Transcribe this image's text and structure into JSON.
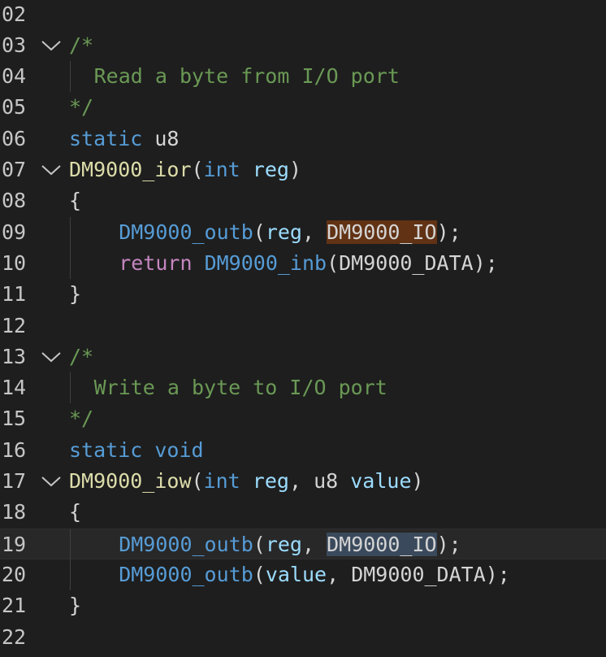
{
  "editor": {
    "lines": [
      {
        "num": "02",
        "fold": false,
        "indent": 0,
        "tokens": []
      },
      {
        "num": "03",
        "fold": true,
        "indent": 0,
        "tokens": [
          {
            "t": "/*",
            "c": "cm"
          }
        ]
      },
      {
        "num": "04",
        "fold": false,
        "indent": 2,
        "tokens": [
          {
            "t": "Read a byte from I/O port",
            "c": "cm"
          }
        ]
      },
      {
        "num": "05",
        "fold": false,
        "indent": 0,
        "tokens": [
          {
            "t": "*/",
            "c": "cm"
          }
        ]
      },
      {
        "num": "06",
        "fold": false,
        "indent": 0,
        "tokens": [
          {
            "t": "static",
            "c": "kw"
          },
          {
            "t": " ",
            "c": "pn"
          },
          {
            "t": "u8",
            "c": "pn"
          }
        ]
      },
      {
        "num": "07",
        "fold": true,
        "indent": 0,
        "tokens": [
          {
            "t": "DM9000_ior",
            "c": "fn"
          },
          {
            "t": "(",
            "c": "pn"
          },
          {
            "t": "int",
            "c": "kw"
          },
          {
            "t": " ",
            "c": "pn"
          },
          {
            "t": "reg",
            "c": "var"
          },
          {
            "t": ")",
            "c": "pn"
          }
        ]
      },
      {
        "num": "08",
        "fold": false,
        "indent": 0,
        "tokens": [
          {
            "t": "{",
            "c": "pn"
          }
        ]
      },
      {
        "num": "09",
        "fold": false,
        "indent": 4,
        "tokens": [
          {
            "t": "DM9000_outb",
            "c": "mac"
          },
          {
            "t": "(",
            "c": "pn"
          },
          {
            "t": "reg",
            "c": "var"
          },
          {
            "t": ", ",
            "c": "pn"
          },
          {
            "t": "DM9000_IO",
            "c": "pn",
            "hl": "occ"
          },
          {
            "t": ");",
            "c": "pn"
          }
        ]
      },
      {
        "num": "10",
        "fold": false,
        "indent": 4,
        "tokens": [
          {
            "t": "return",
            "c": "ctl"
          },
          {
            "t": " ",
            "c": "pn"
          },
          {
            "t": "DM9000_inb",
            "c": "mac"
          },
          {
            "t": "(DM9000_DATA);",
            "c": "pn"
          }
        ]
      },
      {
        "num": "11",
        "fold": false,
        "indent": 0,
        "tokens": [
          {
            "t": "}",
            "c": "pn"
          }
        ]
      },
      {
        "num": "12",
        "fold": false,
        "indent": 0,
        "tokens": []
      },
      {
        "num": "13",
        "fold": true,
        "indent": 0,
        "tokens": [
          {
            "t": "/*",
            "c": "cm"
          }
        ]
      },
      {
        "num": "14",
        "fold": false,
        "indent": 2,
        "tokens": [
          {
            "t": "Write a byte to I/O port",
            "c": "cm"
          }
        ]
      },
      {
        "num": "15",
        "fold": false,
        "indent": 0,
        "tokens": [
          {
            "t": "*/",
            "c": "cm"
          }
        ]
      },
      {
        "num": "16",
        "fold": false,
        "indent": 0,
        "tokens": [
          {
            "t": "static",
            "c": "kw"
          },
          {
            "t": " ",
            "c": "pn"
          },
          {
            "t": "void",
            "c": "kw"
          }
        ]
      },
      {
        "num": "17",
        "fold": true,
        "indent": 0,
        "tokens": [
          {
            "t": "DM9000_iow",
            "c": "fn"
          },
          {
            "t": "(",
            "c": "pn"
          },
          {
            "t": "int",
            "c": "kw"
          },
          {
            "t": " ",
            "c": "pn"
          },
          {
            "t": "reg",
            "c": "var"
          },
          {
            "t": ", ",
            "c": "pn"
          },
          {
            "t": "u8",
            "c": "pn"
          },
          {
            "t": " ",
            "c": "pn"
          },
          {
            "t": "value",
            "c": "var"
          },
          {
            "t": ")",
            "c": "pn"
          }
        ]
      },
      {
        "num": "18",
        "fold": false,
        "indent": 0,
        "tokens": [
          {
            "t": "{",
            "c": "pn"
          }
        ]
      },
      {
        "num": "19",
        "fold": false,
        "indent": 4,
        "current": true,
        "tokens": [
          {
            "t": "DM9000_outb",
            "c": "mac"
          },
          {
            "t": "(",
            "c": "pn"
          },
          {
            "t": "reg",
            "c": "var"
          },
          {
            "t": ", ",
            "c": "pn"
          },
          {
            "t": "DM9000_IO",
            "c": "pn",
            "hl": "sel"
          },
          {
            "t": ");",
            "c": "pn"
          }
        ]
      },
      {
        "num": "20",
        "fold": false,
        "indent": 4,
        "tokens": [
          {
            "t": "DM9000_outb",
            "c": "mac"
          },
          {
            "t": "(",
            "c": "pn"
          },
          {
            "t": "value",
            "c": "var"
          },
          {
            "t": ", DM9000_DATA);",
            "c": "pn"
          }
        ]
      },
      {
        "num": "21",
        "fold": false,
        "indent": 0,
        "tokens": [
          {
            "t": "}",
            "c": "pn"
          }
        ]
      },
      {
        "num": "22",
        "fold": false,
        "indent": 0,
        "tokens": []
      }
    ]
  },
  "colors": {
    "background": "#1e1e1e",
    "comment": "#6a9955",
    "keyword": "#569cd6",
    "control": "#c586c0",
    "function": "#dcdcaa",
    "variable": "#9cdcfe",
    "occurrence_highlight": "#613214",
    "selection_highlight": "#3a4a5c"
  },
  "icons": {
    "fold": "chevron-down-icon"
  }
}
